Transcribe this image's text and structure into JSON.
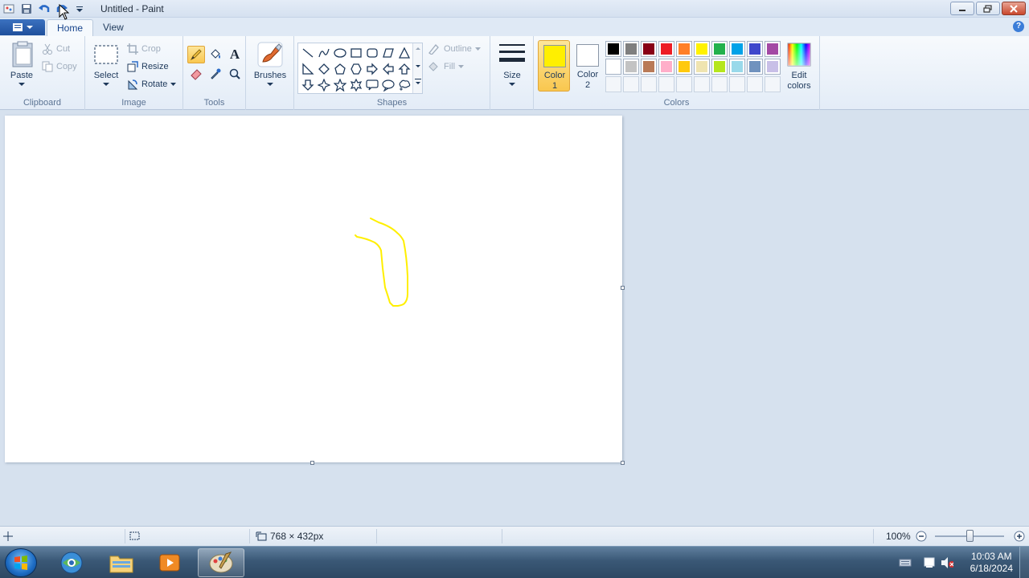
{
  "window": {
    "title": "Untitled - Paint"
  },
  "tabs": [
    {
      "label": "Home"
    },
    {
      "label": "View"
    }
  ],
  "clipboard": {
    "paste": "Paste",
    "cut": "Cut",
    "copy": "Copy",
    "group": "Clipboard"
  },
  "image": {
    "select": "Select",
    "crop": "Crop",
    "resize": "Resize",
    "rotate": "Rotate",
    "group": "Image"
  },
  "tools": {
    "group": "Tools",
    "text_glyph": "A"
  },
  "brushes": {
    "label": "Brushes"
  },
  "shapes": {
    "outline": "Outline",
    "fill": "Fill",
    "group": "Shapes"
  },
  "size": {
    "label": "Size"
  },
  "colors": {
    "color1_label_1": "Color",
    "color1_label_2": "1",
    "color2_label_1": "Color",
    "color2_label_2": "2",
    "edit_label_1": "Edit",
    "edit_label_2": "colors",
    "group": "Colors",
    "color1": "#ffef00",
    "color2": "#ffffff",
    "palette_row1": [
      "#000000",
      "#7f7f7f",
      "#880015",
      "#ed1c24",
      "#ff7f27",
      "#fff200",
      "#22b14c",
      "#00a2e8",
      "#3f48cc",
      "#a349a4"
    ],
    "palette_row2": [
      "#ffffff",
      "#c3c3c3",
      "#b97a57",
      "#ffaec9",
      "#ffc90e",
      "#efe4b0",
      "#b5e61d",
      "#99d9ea",
      "#7092be",
      "#c8bfe7"
    ]
  },
  "drawing": {
    "stroke_color": "#ffef00"
  },
  "statusbar": {
    "canvas_size": "768 × 432px",
    "zoom": "100%"
  },
  "taskbar": {
    "time": "10:03 AM",
    "date": "6/18/2024"
  }
}
